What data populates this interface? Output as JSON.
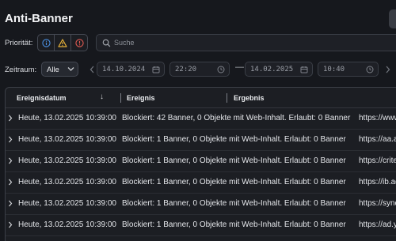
{
  "page": {
    "title": "Anti-Banner"
  },
  "filters": {
    "priority_label": "Priorität:",
    "priority_icons": [
      "info-icon",
      "warning-icon",
      "error-icon"
    ],
    "search_placeholder": "Suche",
    "period_label": "Zeitraum:",
    "period_value": "Alle",
    "from_date": "14.10.2024",
    "from_time": "22:20",
    "to_date": "14.02.2025",
    "to_time": "10:40",
    "range_separator": "—"
  },
  "colors": {
    "info": "#4a8fe0",
    "warning": "#e8b33a",
    "error": "#e05a52"
  },
  "table": {
    "columns": [
      "Ereignisdatum",
      "Ereignis",
      "Ergebnis"
    ],
    "sort_indicator": "↓",
    "rows": [
      {
        "date": "Heute, 13.02.2025 10:39:00",
        "event": "Blockiert: 42 Banner, 0 Objekte mit Web-Inhalt. Erlaubt: 0 Banner",
        "result": "https://www.t"
      },
      {
        "date": "Heute, 13.02.2025 10:39:00",
        "event": "Blockiert: 1 Banner, 0 Objekte mit Web-Inhalt. Erlaubt: 0 Banner",
        "result": "https://aa.ag"
      },
      {
        "date": "Heute, 13.02.2025 10:39:00",
        "event": "Blockiert: 1 Banner, 0 Objekte mit Web-Inhalt. Erlaubt: 0 Banner",
        "result": "https://criteo"
      },
      {
        "date": "Heute, 13.02.2025 10:39:00",
        "event": "Blockiert: 1 Banner, 0 Objekte mit Web-Inhalt. Erlaubt: 0 Banner",
        "result": "https://ib.adn"
      },
      {
        "date": "Heute, 13.02.2025 10:39:00",
        "event": "Blockiert: 1 Banner, 0 Objekte mit Web-Inhalt. Erlaubt: 0 Banner",
        "result": "https://synd"
      },
      {
        "date": "Heute, 13.02.2025 10:39:00",
        "event": "Blockiert: 1 Banner, 0 Objekte mit Web-Inhalt. Erlaubt: 0 Banner",
        "result": "https://ad.y"
      }
    ]
  }
}
